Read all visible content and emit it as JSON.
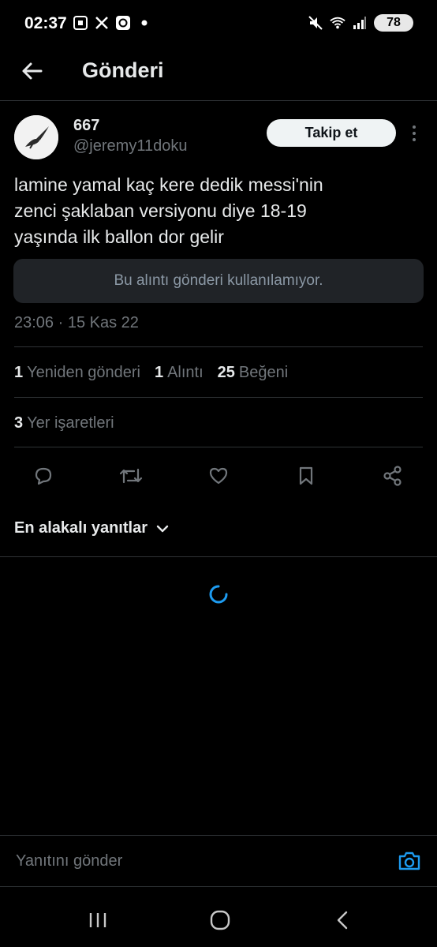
{
  "status_bar": {
    "time": "02:37",
    "battery": "78",
    "icons_left": [
      "screenshot-icon",
      "x-app-icon",
      "threads-icon",
      "dot-icon"
    ],
    "icons_right": [
      "mute-icon",
      "wifi-icon",
      "signal-icon",
      "battery-icon"
    ]
  },
  "header": {
    "title": "Gönderi"
  },
  "tweet": {
    "author_name": "667",
    "author_handle": "@jeremy11doku",
    "follow_label": "Takip et",
    "text": "lamine yamal kaç kere dedik messi'nin\nzenci şaklaban versiyonu diye 18-19\nyaşında ilk ballon dor gelir",
    "quote_unavailable": "Bu alıntı gönderi kullanılamıyor.",
    "timestamp": "23:06 · 15 Kas 22"
  },
  "stats": {
    "reposts_count": "1",
    "reposts_label": "Yeniden gönderi",
    "quotes_count": "1",
    "quotes_label": "Alıntı",
    "likes_count": "25",
    "likes_label": "Beğeni",
    "bookmarks_count": "3",
    "bookmarks_label": "Yer işaretleri"
  },
  "actions": [
    "reply-icon",
    "repost-icon",
    "like-icon",
    "bookmark-icon",
    "share-icon"
  ],
  "replies": {
    "sort_label": "En alakalı yanıtlar"
  },
  "reply_bar": {
    "placeholder": "Yanıtını gönder"
  },
  "colors": {
    "background": "#000000",
    "text": "#e7e9ea",
    "secondary": "#71767b",
    "accent": "#1d9bf0",
    "border": "#2f3336"
  }
}
